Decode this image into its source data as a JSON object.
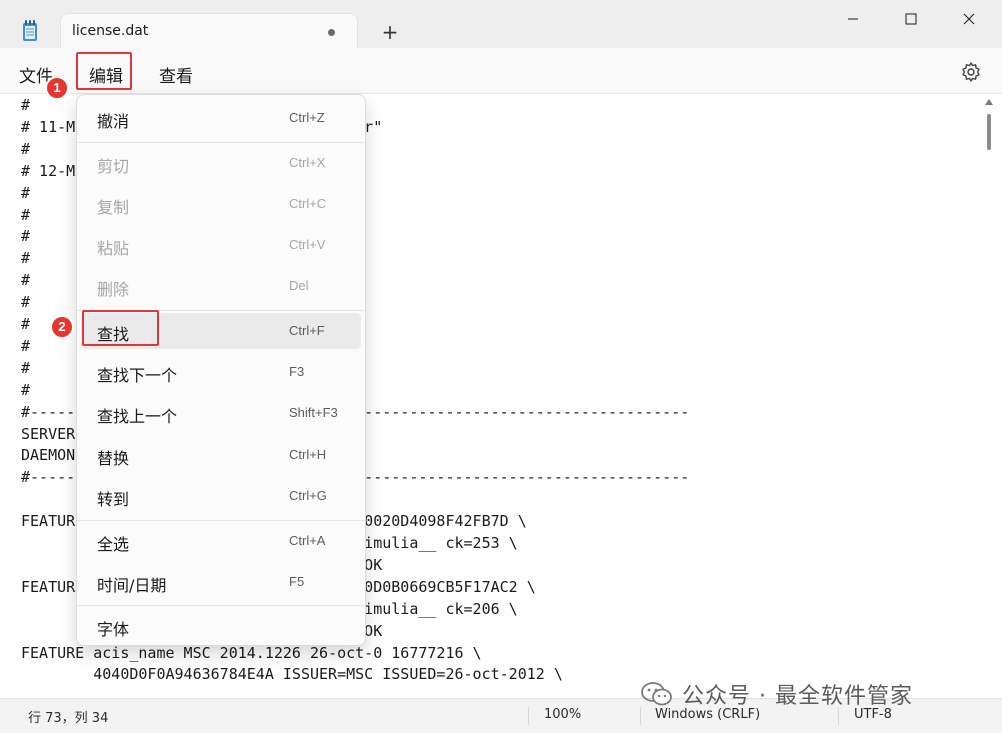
{
  "window": {
    "tab_title": "license.dat",
    "new_tab_icon": "+"
  },
  "menubar": {
    "file": "文件",
    "edit": "编辑",
    "view": "查看"
  },
  "editor_lines": [
    "#",
    "# 11-M                    \" matc_server\"",
    "#",
    "# 12-M                  ng features:",
    "#",
    "#",
    "#",
    "#                       u",
    "#",
    "#",
    "#                          _nu",
    "#                         _nu",
    "#",
    "#",
    "#-------------------------------------------------------------------------",
    "SERVER",
    "DAEMON",
    "#-------------------------------------------------------------------------",
    "",
    "FEATURE                  16777216 D0000020D4098F42FB7D \\",
    "                        012 NOTICE=__Simulia__ ck=253 \\",
    "                        0038a-4f9f TS_OK",
    "FEATURE                 0 16777216 E090D0B0669CB5F17AC2 \\",
    "                        012 NOTICE=__Simulia__ ck=206 \\",
    "                        af8f3-d013 TS_OK",
    "FEATURE acis_name MSC 2014.1226 26-oct-0 16777216 \\",
    "        4040D0F0A94636784E4A ISSUER=MSC ISSUED=26-oct-2012 \\"
  ],
  "edit_menu": {
    "groups": [
      [
        {
          "label": "撤消",
          "shortcut": "Ctrl+Z",
          "enabled": true
        }
      ],
      [
        {
          "label": "剪切",
          "shortcut": "Ctrl+X",
          "enabled": false
        },
        {
          "label": "复制",
          "shortcut": "Ctrl+C",
          "enabled": false
        },
        {
          "label": "粘贴",
          "shortcut": "Ctrl+V",
          "enabled": false
        },
        {
          "label": "删除",
          "shortcut": "Del",
          "enabled": false
        }
      ],
      [
        {
          "label": "查找",
          "shortcut": "Ctrl+F",
          "enabled": true
        },
        {
          "label": "查找下一个",
          "shortcut": "F3",
          "enabled": true
        },
        {
          "label": "查找上一个",
          "shortcut": "Shift+F3",
          "enabled": true
        },
        {
          "label": "替换",
          "shortcut": "Ctrl+H",
          "enabled": true
        },
        {
          "label": "转到",
          "shortcut": "Ctrl+G",
          "enabled": true
        }
      ],
      [
        {
          "label": "全选",
          "shortcut": "Ctrl+A",
          "enabled": true
        },
        {
          "label": "时间/日期",
          "shortcut": "F5",
          "enabled": true
        }
      ],
      [
        {
          "label": "字体",
          "shortcut": "",
          "enabled": true
        }
      ]
    ]
  },
  "annotations": {
    "step1": "1",
    "step2": "2",
    "highlight_color": "#d93a3a",
    "badge_color": "#e3372f"
  },
  "statusbar": {
    "position": "行 73，列 34",
    "zoom": "100%",
    "line_ending": "Windows (CRLF)",
    "encoding": "UTF-8"
  },
  "watermark": {
    "text": "公众号 · 最全软件管家"
  },
  "icons": {
    "app": "notepad-icon",
    "settings": "gear-icon",
    "watermark": "wechat-icon"
  }
}
